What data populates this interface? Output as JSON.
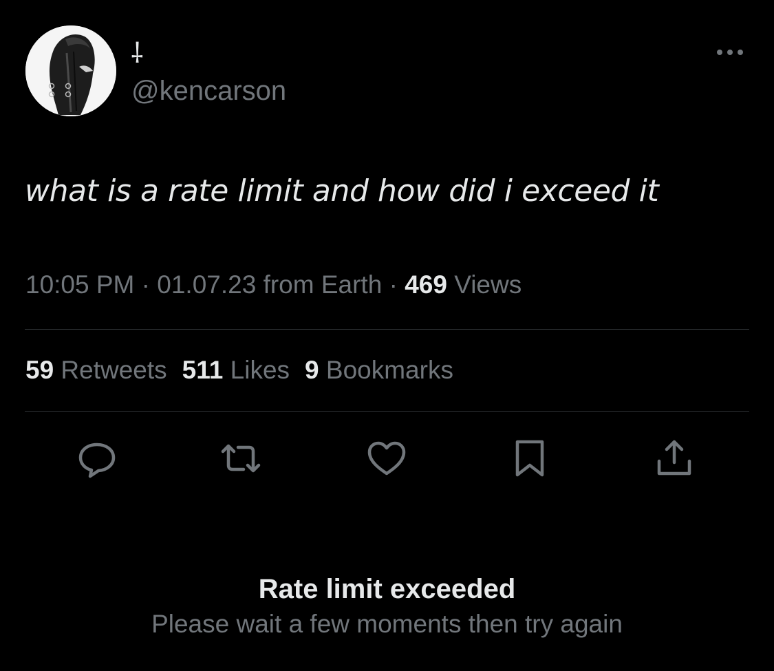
{
  "tweet": {
    "display_name": "⸸",
    "handle": "@kencarson",
    "text": "what is a rate limit and how did i exceed it",
    "time": "10:05 PM",
    "sep1": " · ",
    "date": "01.07.23",
    "source": " from Earth",
    "sep2": " · ",
    "views_count": "469",
    "views_label": " Views",
    "retweets_count": "59",
    "retweets_label": " Retweets",
    "likes_count": "511",
    "likes_label": " Likes",
    "bookmarks_count": "9",
    "bookmarks_label": " Bookmarks"
  },
  "actions": [
    {
      "name": "reply",
      "icon": "reply-icon"
    },
    {
      "name": "retweet",
      "icon": "retweet-icon"
    },
    {
      "name": "like",
      "icon": "heart-icon"
    },
    {
      "name": "bookmark",
      "icon": "bookmark-icon"
    },
    {
      "name": "share",
      "icon": "share-icon"
    }
  ],
  "error": {
    "title": "Rate limit exceeded",
    "message": "Please wait a few moments then try again"
  },
  "colors": {
    "background": "#000000",
    "text_primary": "#e7e9ea",
    "text_secondary": "#71767b",
    "divider": "#2f3336"
  }
}
